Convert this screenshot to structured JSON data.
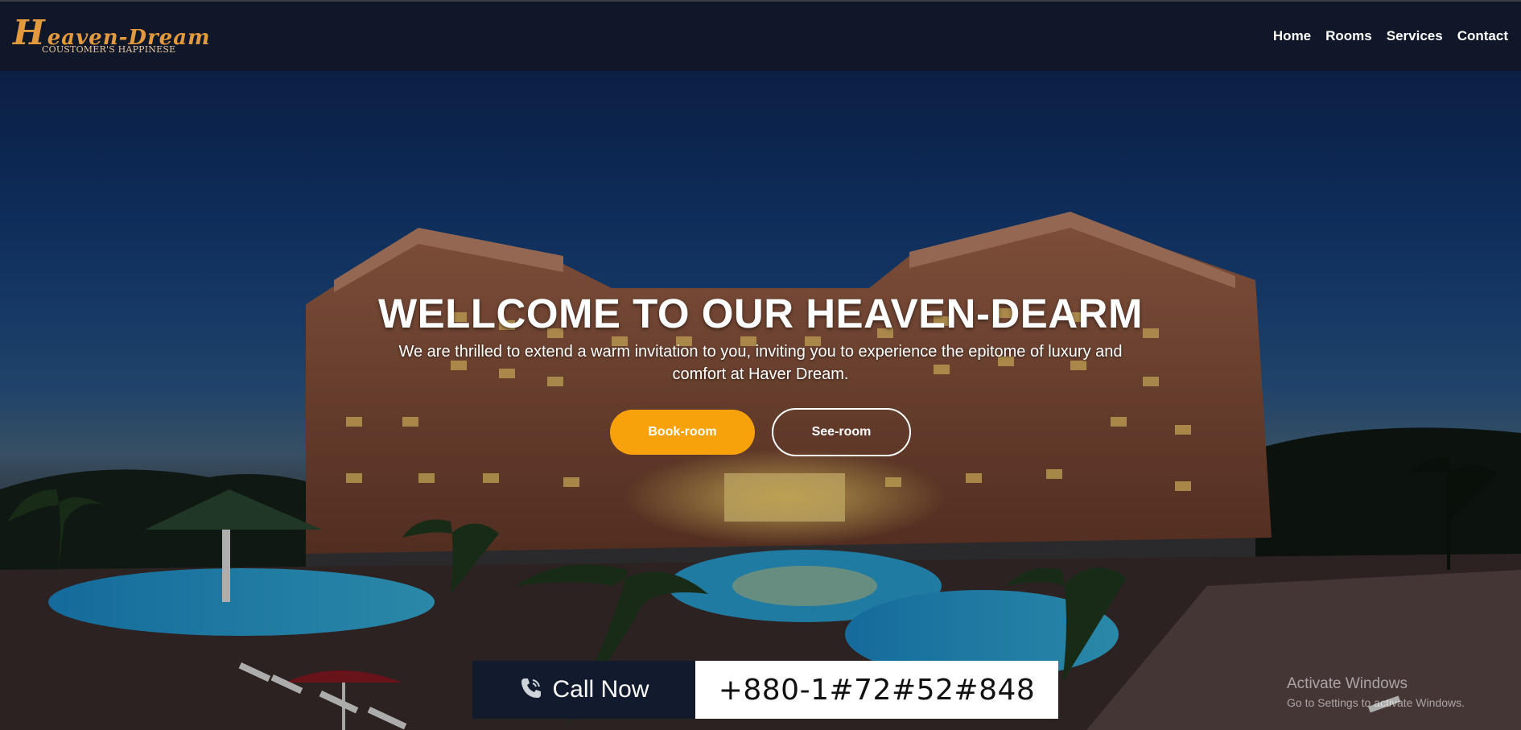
{
  "brand": {
    "logo_first_letter": "H",
    "logo_rest": "eaven-Dream",
    "tagline": "COUSTOMER'S HAPPINESE"
  },
  "nav": {
    "items": [
      {
        "label": "Home"
      },
      {
        "label": "Rooms"
      },
      {
        "label": "Services"
      },
      {
        "label": "Contact"
      }
    ]
  },
  "hero": {
    "title": "WELLCOME TO OUR HEAVEN-DEARM",
    "subtitle": "We are thrilled to extend a warm invitation to you, inviting you to experience the epitome of luxury and comfort at Haver Dream.",
    "book_label": "Book-room",
    "see_label": "See-room"
  },
  "call": {
    "label": "Call Now",
    "number": "+880-1#72#52#848",
    "icon": "phone-icon"
  },
  "watermark": {
    "title": "Activate Windows",
    "subtitle": "Go to Settings to activate Windows."
  },
  "colors": {
    "nav_bg": "#0f1729",
    "brand_accent": "#e39a3d",
    "primary_button": "#f8a20b",
    "call_bg": "#121b2d"
  }
}
